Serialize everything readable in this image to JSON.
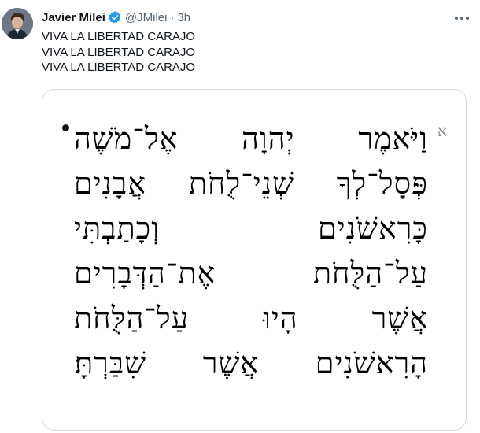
{
  "tweet": {
    "author_name": "Javier Milei",
    "handle": "@JMilei",
    "separator": "·",
    "time": "3h",
    "text_lines": [
      "VIVA LA LIBERTAD CARAJO",
      "VIVA LA LIBERTAD CARAJO",
      "VIVA LA LIBERTAD CARAJO"
    ],
    "icons": {
      "verified": "verified-badge-icon",
      "more": "more-options-icon"
    },
    "colors": {
      "verified": "#1d9bf0",
      "secondary_text": "#536471",
      "border": "#cfd9de"
    }
  },
  "media": {
    "verse_number": "א",
    "hebrew_lines": [
      "וַיֹּאמֶר יְהוָה אֶל־מֹשֶׁה",
      "פְּסָל־לְךָ שְׁנֵי־לֻחֹת אֲבָנִים",
      "כָּרִאשֹׁנִים וְכָתַבְתִּי",
      "עַל־הַלֻּחֹת אֶת־הַדְּבָרִים",
      "אֲשֶׁר הָיוּ עַל־הַלֻּחֹת",
      "הָרִאשֹׁנִים אֲשֶׁר שִׁבַּרְתָּ׃"
    ]
  }
}
